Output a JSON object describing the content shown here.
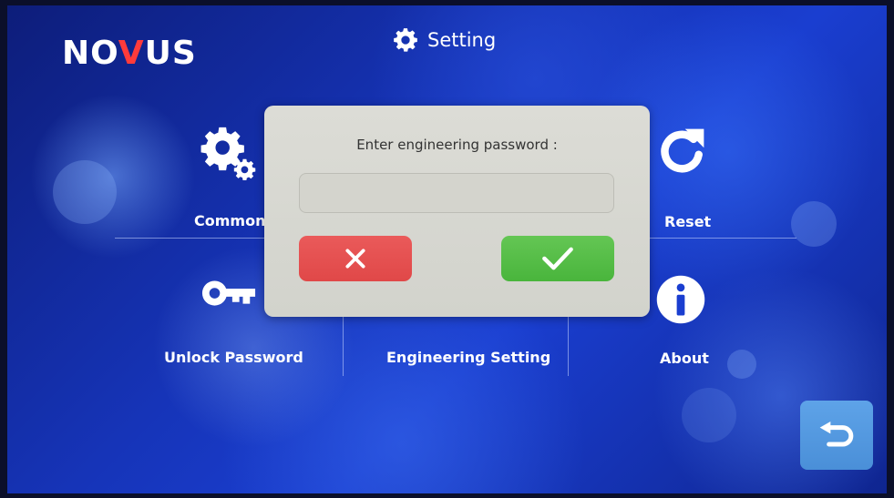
{
  "brand": {
    "logo_left": "NO",
    "logo_v": "V",
    "logo_right": "US"
  },
  "header": {
    "title": "Setting",
    "icon": "gear-icon"
  },
  "menu": {
    "items": [
      {
        "label": "Common",
        "icon": "gears-icon"
      },
      {
        "label": "Reset",
        "icon": "refresh-icon"
      },
      {
        "label": "Unlock Password",
        "icon": "key-icon"
      },
      {
        "label": "Engineering Setting",
        "icon": "wrench-icon"
      },
      {
        "label": "About",
        "icon": "info-icon"
      }
    ]
  },
  "dialog": {
    "prompt": "Enter engineering password :",
    "password_value": "",
    "cancel_icon": "close-icon",
    "confirm_icon": "check-icon"
  },
  "footer": {
    "back_icon": "return-arrow-icon"
  },
  "colors": {
    "cancel": "#e04848",
    "confirm": "#49b53c",
    "back": "#4a8fd8",
    "logo_v": "#ff3b3b"
  }
}
